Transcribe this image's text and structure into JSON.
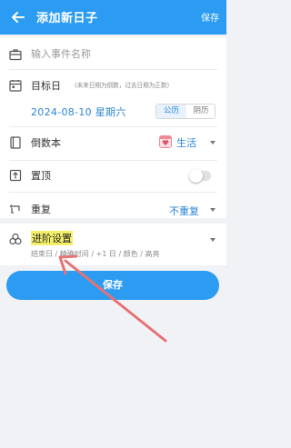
{
  "header": {
    "title": "添加新日子",
    "save_label": "保存"
  },
  "form": {
    "name_placeholder": "输入事件名称",
    "target_date_label": "目标日",
    "target_date_hint": "(未来日期为倒数，过去日期为正数)",
    "date_value": "2024-08-10 星期六",
    "calendar_options": [
      "公历",
      "阴历"
    ],
    "calendar_selected": "公历",
    "book_label": "倒数本",
    "book_value": "生活",
    "pin_label": "置顶",
    "pin_enabled": false,
    "repeat_label": "重复",
    "repeat_value": "不重复"
  },
  "advanced": {
    "title": "进阶设置",
    "subtitle": "结束日 / 精确时间 / +1 日 / 颜色 / 高亮"
  },
  "save_button_label": "保存",
  "colors": {
    "accent": "#2b9cf2",
    "annotation_arrow": "#e57373"
  }
}
